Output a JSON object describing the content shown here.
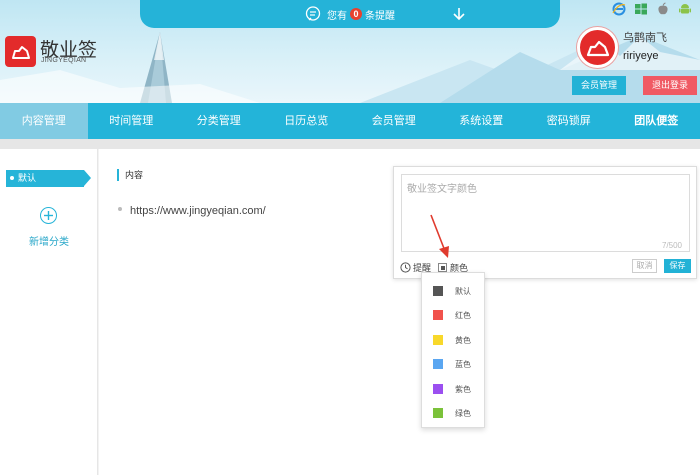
{
  "brand": {
    "name": "敬业签",
    "sub": "JINGYEQIAN"
  },
  "notice": {
    "prefix": "您有",
    "count": "0",
    "suffix": "条提醒"
  },
  "platforms": [
    "ie-icon",
    "windows-icon",
    "apple-icon",
    "android-icon"
  ],
  "user": {
    "nickname": "乌鹊南飞",
    "username": "ririyeye",
    "member_label": "会员管理",
    "logout_label": "退出登录"
  },
  "nav": {
    "tabs": [
      {
        "label": "内容管理",
        "active": true
      },
      {
        "label": "时间管理"
      },
      {
        "label": "分类管理"
      },
      {
        "label": "日历总览"
      },
      {
        "label": "会员管理"
      },
      {
        "label": "系统设置"
      },
      {
        "label": "密码锁屏"
      },
      {
        "label": "团队便签"
      }
    ]
  },
  "sidebar": {
    "default_category": "默认",
    "add_category": "新增分类"
  },
  "main": {
    "column_header": "内容",
    "notes": [
      {
        "text": "https://www.jingyeqian.com/"
      }
    ]
  },
  "editor": {
    "placeholder": "敬业签文字颜色",
    "char_count": "7/500",
    "remind_label": "提醒",
    "color_label": "颜色",
    "cancel_label": "取消",
    "save_label": "保存"
  },
  "color_menu": {
    "items": [
      {
        "label": "默认",
        "color": "#555555"
      },
      {
        "label": "红色",
        "color": "#f1524c"
      },
      {
        "label": "黄色",
        "color": "#f8d82b"
      },
      {
        "label": "蓝色",
        "color": "#5aa6f1"
      },
      {
        "label": "紫色",
        "color": "#9b4ff0"
      },
      {
        "label": "绿色",
        "color": "#7bc23a"
      }
    ]
  },
  "colors": {
    "accent": "#23b4d9",
    "logout": "#f05a64",
    "brand_red": "#e32b2b"
  }
}
